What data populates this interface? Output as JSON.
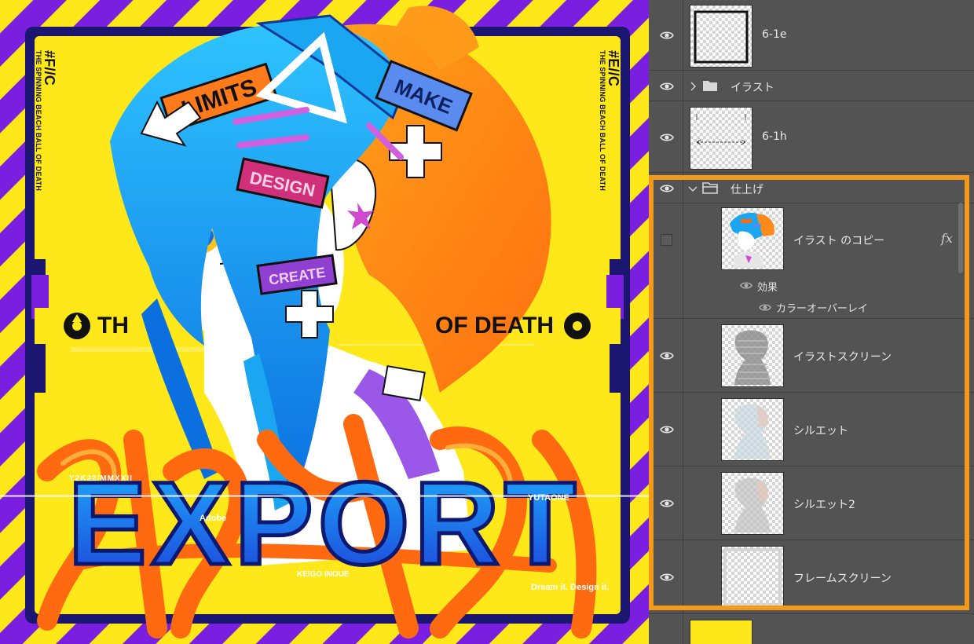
{
  "artwork": {
    "side_left_lines": [
      "#F//C",
      "THE SPINNING BEACH BALL OF DEATH"
    ],
    "side_right_lines": [
      "#E//C",
      "THE SPINNING BEACH BALL OF DEATH"
    ],
    "banner_left": "TH",
    "banner_right": "OF DEATH",
    "logo_text": "EXPORT",
    "year_text": "Y2K22/MMXXII",
    "adobe_text": "Adobe",
    "yuta_text": "YUTAONE",
    "keigo_text": "KEIGO INOUE",
    "tagline": "Dream it. Design it.",
    "sticker_labels": [
      "LIMITS",
      "MAKE",
      "DESIGN",
      "CREATE"
    ],
    "colors": {
      "yellow": "#ffe81a",
      "purple": "#7a1fe0",
      "cyan": "#1aa6f0",
      "orange": "#ff7a1a",
      "navy": "#1b1670"
    }
  },
  "layers_panel": {
    "highlight_color": "#f39a1c",
    "layers": [
      {
        "name": "6-1e",
        "visible": true,
        "kind": "layer",
        "thumb": "frame-border"
      },
      {
        "name": "イラスト",
        "visible": true,
        "kind": "group",
        "expanded": false
      },
      {
        "name": "6-1h",
        "visible": true,
        "kind": "layer",
        "thumb": "dashed-guide"
      },
      {
        "name": "仕上げ",
        "visible": true,
        "kind": "group",
        "expanded": true
      },
      {
        "name": "イラスト のコピー",
        "visible": false,
        "kind": "layer",
        "thumb": "illustration",
        "fx": "fx",
        "effects_label": "効果",
        "effect_name": "カラーオーバーレイ"
      },
      {
        "name": "イラストスクリーン",
        "visible": true,
        "kind": "layer",
        "thumb": "gray-silhouette"
      },
      {
        "name": "シルエット",
        "visible": true,
        "kind": "layer",
        "thumb": "pale-silhouette"
      },
      {
        "name": "シルエット2",
        "visible": true,
        "kind": "layer",
        "thumb": "pale-silhouette"
      },
      {
        "name": "フレームスクリーン",
        "visible": true,
        "kind": "layer",
        "thumb": "faint-frame"
      },
      {
        "name": "",
        "visible": false,
        "kind": "layer",
        "thumb": "yellow-fill"
      }
    ]
  }
}
